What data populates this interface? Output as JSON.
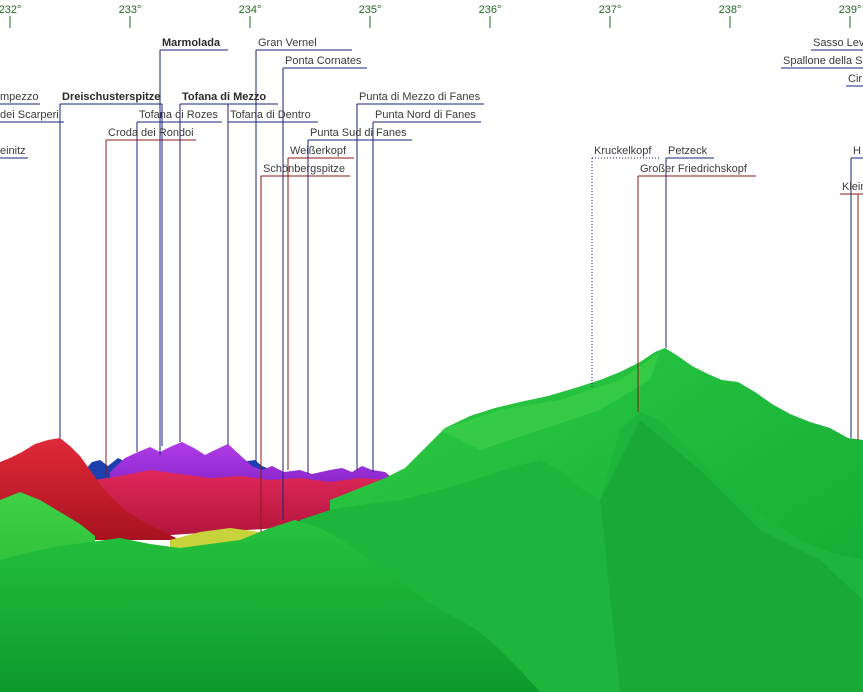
{
  "panorama": {
    "azimuth_ticks": [
      "232°",
      "233°",
      "234°",
      "235°",
      "236°",
      "237°",
      "238°",
      "239°"
    ],
    "colors": {
      "label_line_dark": "#1a237e",
      "label_line_red": "#8b1a1a",
      "tick": "#1d6b1d",
      "ridge_green": "#2fbf3a",
      "ridge_red": "#c4182e",
      "ridge_purple": "#9b2fd8",
      "ridge_blue": "#1e3fb0"
    },
    "peaks": [
      {
        "name": "Marmolada",
        "bold": true
      },
      {
        "name": "Gran Vernel",
        "bold": false
      },
      {
        "name": "Ponta Cornates",
        "bold": false
      },
      {
        "name": "mpezzo",
        "bold": false
      },
      {
        "name": "Dreischusterspitze",
        "bold": true
      },
      {
        "name": "Tofana di Mezzo",
        "bold": true
      },
      {
        "name": "Punta di Mezzo di Fanes",
        "bold": false
      },
      {
        "name": "dei Scarperi",
        "bold": false
      },
      {
        "name": "Tofana di Rozes",
        "bold": false
      },
      {
        "name": "Tofana di Dentro",
        "bold": false
      },
      {
        "name": "Punta Nord di Fanes",
        "bold": false
      },
      {
        "name": "Croda dei Rondoi",
        "bold": false
      },
      {
        "name": "Punta Sud di Fanes",
        "bold": false
      },
      {
        "name": "einitz",
        "bold": false
      },
      {
        "name": "Weißerkopf",
        "bold": false
      },
      {
        "name": "Schönbergspitze",
        "bold": false
      },
      {
        "name": "Kruckelkopf",
        "bold": false
      },
      {
        "name": "Petzeck",
        "bold": false
      },
      {
        "name": "Großer Friedrichskopf",
        "bold": false
      },
      {
        "name": "Sasso Lev",
        "bold": false
      },
      {
        "name": "Spallone della S",
        "bold": false
      },
      {
        "name": "Cir",
        "bold": false
      },
      {
        "name": "H",
        "bold": false
      },
      {
        "name": "Klein",
        "bold": false
      }
    ]
  }
}
